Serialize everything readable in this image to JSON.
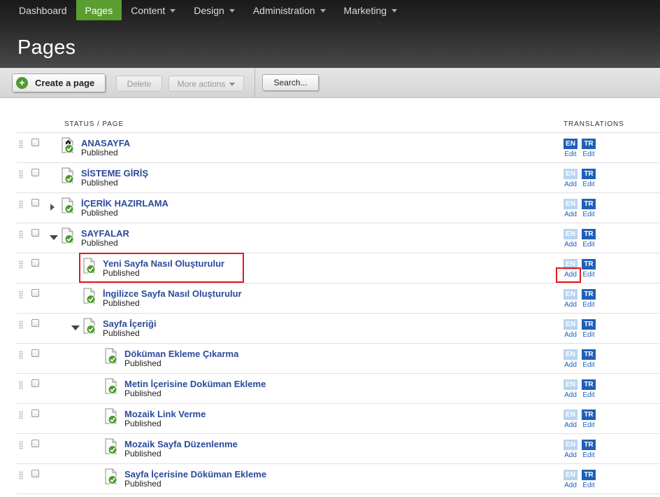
{
  "nav": {
    "items": [
      {
        "label": "Dashboard",
        "dropdown": false,
        "active": false
      },
      {
        "label": "Pages",
        "dropdown": false,
        "active": true
      },
      {
        "label": "Content",
        "dropdown": true,
        "active": false
      },
      {
        "label": "Design",
        "dropdown": true,
        "active": false
      },
      {
        "label": "Administration",
        "dropdown": true,
        "active": false
      },
      {
        "label": "Marketing",
        "dropdown": true,
        "active": false
      }
    ]
  },
  "page": {
    "title": "Pages"
  },
  "toolbar": {
    "create_label": "Create a page",
    "delete_label": "Delete",
    "more_label": "More actions",
    "search_label": "Search..."
  },
  "table": {
    "status_header": "STATUS / PAGE",
    "translations_header": "TRANSLATIONS",
    "rows": [
      {
        "name": "ANASAYFA",
        "status": "Published",
        "level": 0,
        "toggle": "none",
        "home": true,
        "en": "Edit",
        "tr": "Edit"
      },
      {
        "name": "SİSTEME GİRİŞ",
        "status": "Published",
        "level": 0,
        "toggle": "none",
        "home": false,
        "en": "Add",
        "tr": "Edit"
      },
      {
        "name": "İÇERİK HAZIRLAMA",
        "status": "Published",
        "level": 0,
        "toggle": "collapsed",
        "home": false,
        "en": "Add",
        "tr": "Edit"
      },
      {
        "name": "SAYFALAR",
        "status": "Published",
        "level": 0,
        "toggle": "expanded",
        "home": false,
        "en": "Add",
        "tr": "Edit"
      },
      {
        "name": "Yeni Sayfa Nasıl Oluşturulur",
        "status": "Published",
        "level": 1,
        "toggle": "none",
        "home": false,
        "en": "Add",
        "tr": "Edit"
      },
      {
        "name": "İngilizce Sayfa Nasıl Oluşturulur",
        "status": "Published",
        "level": 1,
        "toggle": "none",
        "home": false,
        "en": "Add",
        "tr": "Edit"
      },
      {
        "name": "Sayfa İçeriği",
        "status": "Published",
        "level": 1,
        "toggle": "expanded",
        "home": false,
        "en": "Add",
        "tr": "Edit"
      },
      {
        "name": "Döküman Ekleme Çıkarma",
        "status": "Published",
        "level": 2,
        "toggle": "none",
        "home": false,
        "en": "Add",
        "tr": "Edit"
      },
      {
        "name": "Metin İçerisine Doküman Ekleme",
        "status": "Published",
        "level": 2,
        "toggle": "none",
        "home": false,
        "en": "Add",
        "tr": "Edit"
      },
      {
        "name": "Mozaik Link Verme",
        "status": "Published",
        "level": 2,
        "toggle": "none",
        "home": false,
        "en": "Add",
        "tr": "Edit"
      },
      {
        "name": "Mozaik Sayfa Düzenlenme",
        "status": "Published",
        "level": 2,
        "toggle": "none",
        "home": false,
        "en": "Add",
        "tr": "Edit"
      },
      {
        "name": "Sayfa İçerisine Döküman Ekleme",
        "status": "Published",
        "level": 2,
        "toggle": "none",
        "home": false,
        "en": "Add",
        "tr": "Edit"
      }
    ]
  },
  "languages": [
    "EN",
    "TR"
  ],
  "colors": {
    "accent": "#5a9e2f",
    "link": "#2a4a9a",
    "lang_on": "#1f5fb8",
    "lang_off": "#b7d5ef",
    "highlight": "#e8151b"
  }
}
